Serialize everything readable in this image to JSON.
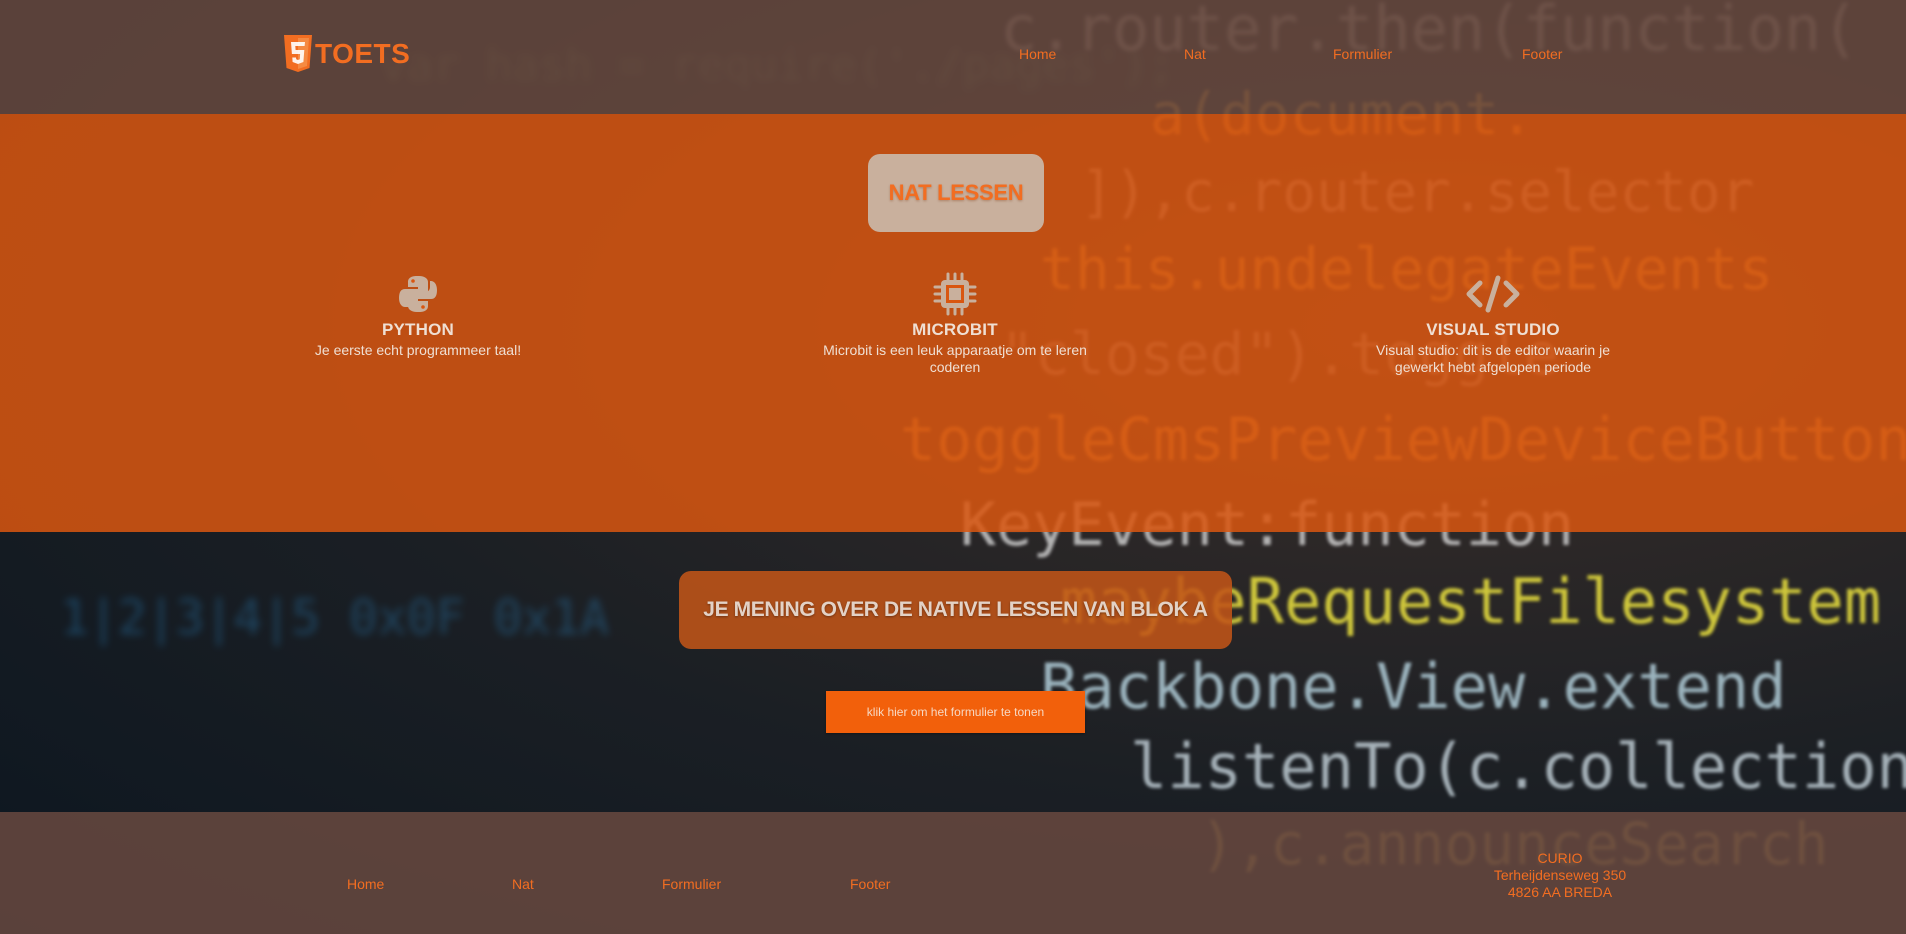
{
  "header": {
    "logo_text": "TOETS",
    "nav": [
      "Home",
      "Nat",
      "Formulier",
      "Footer"
    ]
  },
  "nat_section": {
    "title": "NAT LESSEN",
    "cards": [
      {
        "icon": "python-icon",
        "title": "PYTHON",
        "text": "Je eerste echt programmeer taal!"
      },
      {
        "icon": "microchip-icon",
        "title": "MICROBIT",
        "text": "Microbit is een leuk apparaatje om te leren coderen"
      },
      {
        "icon": "code-icon",
        "title": "VISUAL STUDIO",
        "text": "Visual studio: dit is de editor waarin je gewerkt hebt afgelopen periode"
      }
    ]
  },
  "form_section": {
    "title": "JE MENING OVER DE NATIVE LESSEN VAN BLOK A",
    "button_label": "klik hier om het formulier te tonen"
  },
  "footer": {
    "nav": [
      "Home",
      "Nat",
      "Formulier",
      "Footer"
    ],
    "address": {
      "name": "CURIO",
      "street": "Terheijdenseweg 350",
      "city": "4826 AA BREDA"
    }
  },
  "colors": {
    "accent": "#f26d21",
    "orange_band": "#d95610",
    "header_footer": "#6a4a40",
    "pill": "#c9b09d",
    "card_text": "#efdfd3"
  }
}
